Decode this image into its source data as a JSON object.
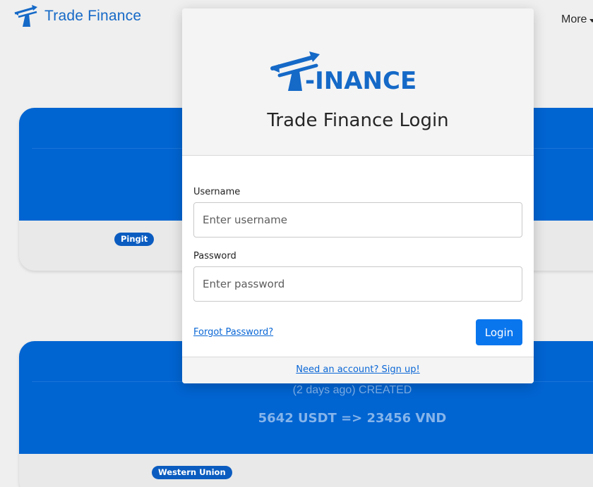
{
  "navbar": {
    "brand_text": "Trade Finance",
    "more_label": "More"
  },
  "orders": [
    {
      "date_status": "",
      "amount": "",
      "payment_method": "Pingit"
    },
    {
      "date_status": "(2 days ago) CREATED",
      "amount": "5642 USDT => 23456 VND",
      "payment_method": "Western Union"
    }
  ],
  "login_modal": {
    "logo_text": "-INANCE",
    "title": "Trade Finance Login",
    "username_label": "Username",
    "username_placeholder": "Enter username",
    "username_value": "",
    "password_label": "Password",
    "password_placeholder": "Enter password",
    "password_value": "",
    "forgot_label": "Forgot Password?",
    "login_label": "Login",
    "signup_label": "Need an account? Sign up!"
  },
  "colors": {
    "brand_blue": "#1569c7",
    "card_blue": "#0064d1",
    "button_blue": "#0a76ee",
    "link_blue": "#0a67d6"
  },
  "icons": {
    "brand_logo": "t-finance-logo-icon"
  }
}
